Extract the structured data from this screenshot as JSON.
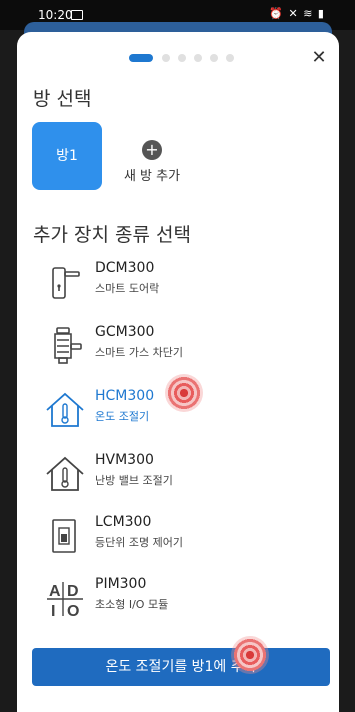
{
  "status_bar": {
    "time": "10:20",
    "right_icons": "⏰ ✕ ≋ ▮"
  },
  "sheet": {
    "room_section_title": "방 선택",
    "rooms": [
      {
        "label": "방1"
      }
    ],
    "add_room_label": "새 방 추가",
    "device_section_title": "추가 장치 종류 선택",
    "devices": [
      {
        "name": "DCM300",
        "desc": "스마트 도어락",
        "icon": "door-lock-icon"
      },
      {
        "name": "GCM300",
        "desc": "스마트 가스 차단기",
        "icon": "gas-valve-icon"
      },
      {
        "name": "HCM300",
        "desc": "온도 조절기",
        "icon": "house-thermometer-icon"
      },
      {
        "name": "HVM300",
        "desc": "난방 밸브 조절기",
        "icon": "house-thermometer-icon"
      },
      {
        "name": "LCM300",
        "desc": "등단위 조명 제어기",
        "icon": "light-switch-icon"
      },
      {
        "name": "PIM300",
        "desc": "초소형 I/O 모듈",
        "icon": "adio-icon"
      }
    ],
    "adio_text": "ADIO",
    "cta_label": "온도 조절기를 방1에 추가"
  },
  "colors": {
    "accent": "#1e78d0",
    "button": "#1f6bbf",
    "selected_room": "#2f90ec"
  }
}
